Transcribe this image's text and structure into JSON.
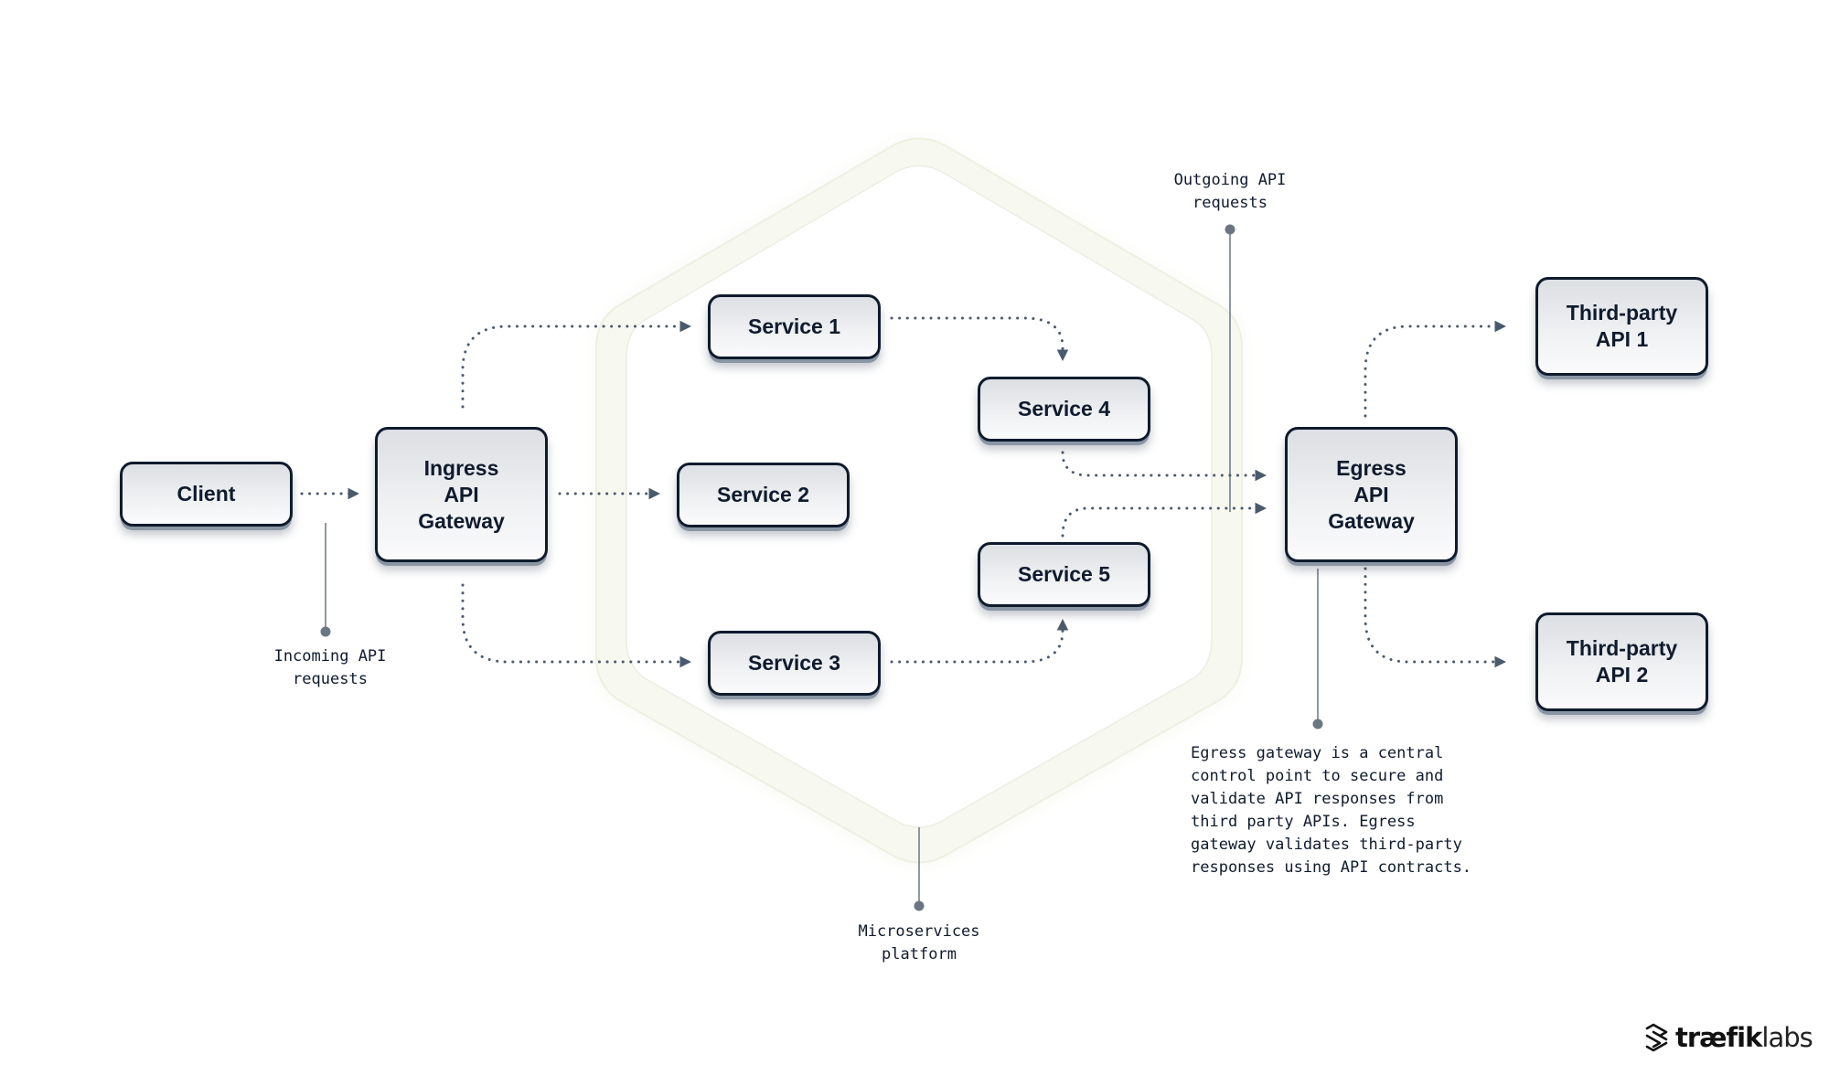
{
  "diagram": {
    "nodes": {
      "client": "Client",
      "ingress": "Ingress\nAPI\nGateway",
      "service1": "Service 1",
      "service2": "Service 2",
      "service3": "Service 3",
      "service4": "Service 4",
      "service5": "Service 5",
      "egress": "Egress\nAPI\nGateway",
      "third_party_1": "Third-party\nAPI 1",
      "third_party_2": "Third-party\nAPI 2"
    },
    "annotations": {
      "incoming": "Incoming API\nrequests",
      "outgoing": "Outgoing API\nrequests",
      "platform": "Microservices\nplatform",
      "egress_note": "Egress gateway is a central\ncontrol point to secure and\nvalidate API responses from\nthird party APIs. Egress\ngateway validates third-party\nresponses using API contracts."
    },
    "edges": [
      {
        "from": "client",
        "to": "ingress"
      },
      {
        "from": "ingress",
        "to": "service1"
      },
      {
        "from": "ingress",
        "to": "service2"
      },
      {
        "from": "ingress",
        "to": "service3"
      },
      {
        "from": "service1",
        "to": "service4"
      },
      {
        "from": "service3",
        "to": "service5"
      },
      {
        "from": "service4",
        "to": "egress"
      },
      {
        "from": "service5",
        "to": "egress"
      },
      {
        "from": "egress",
        "to": "third_party_1"
      },
      {
        "from": "egress",
        "to": "third_party_2"
      }
    ],
    "colors": {
      "node_border": "#0f1b2d",
      "edge": "#4a5a6d",
      "pointer": "#6b7683",
      "platform_glow": "#f3f5e6"
    }
  },
  "brand": {
    "name_bold": "træfik",
    "name_light": "labs",
    "logo_icon": "traefik-logo-icon"
  }
}
